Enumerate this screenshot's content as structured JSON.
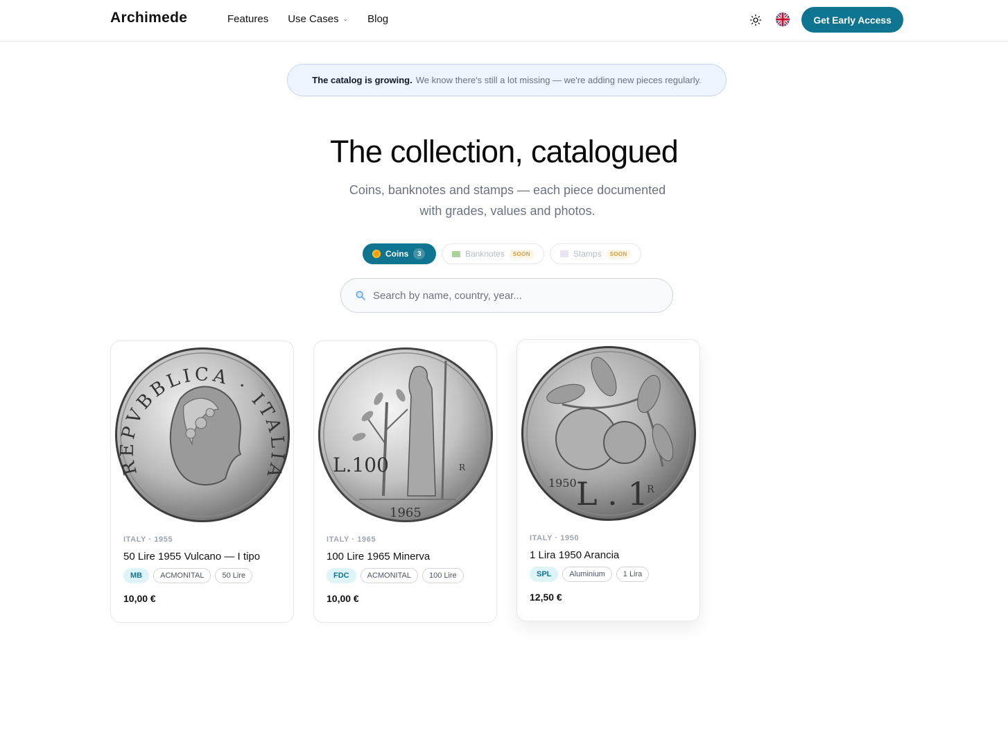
{
  "header": {
    "logo": "Archimede",
    "nav": [
      "Features",
      "Use Cases",
      "Blog"
    ],
    "cta": "Get Early Access",
    "icons": {
      "theme": "sun-icon",
      "language": "uk-flag-icon"
    }
  },
  "notice": {
    "bold": "The catalog is growing.",
    "text": "We know there's still a lot missing — we're adding new pieces regularly."
  },
  "hero": {
    "title": "The collection, catalogued",
    "subtitle_line1": "Coins, banknotes and stamps — each piece documented",
    "subtitle_line2": "with grades, values and photos."
  },
  "tabs": [
    {
      "label": "Coins",
      "count": "3",
      "active": true
    },
    {
      "label": "Banknotes",
      "badge": "SOON"
    },
    {
      "label": "Stamps",
      "badge": "SOON"
    }
  ],
  "search": {
    "placeholder": "Search by name, country, year..."
  },
  "cards": [
    {
      "meta": "ITALY · 1955",
      "name": "50 Lire 1955 Vulcano — I tipo",
      "grade": "MB",
      "tags": [
        "ACMONITAL",
        "50 Lire"
      ],
      "price": "10,00 €",
      "coin_text": "REPVBBLICA · ITALIANA"
    },
    {
      "meta": "ITALY · 1965",
      "name": "100 Lire 1965 Minerva",
      "grade": "FDC",
      "tags": [
        "ACMONITAL",
        "100 Lire"
      ],
      "price": "10,00 €",
      "coin_text": "L.100",
      "coin_year": "1965",
      "coin_mark": "R"
    },
    {
      "meta": "ITALY · 1950",
      "name": "1 Lira 1950 Arancia",
      "grade": "SPL",
      "tags": [
        "Aluminium",
        "1 Lira"
      ],
      "price": "12,50 €",
      "coin_text": "L . 1",
      "coin_year": "1950",
      "coin_mark": "R"
    }
  ],
  "colors": {
    "accent": "#0e7490",
    "notice_bg": "#eef4fd",
    "grade_bg": "#dff4f7"
  }
}
